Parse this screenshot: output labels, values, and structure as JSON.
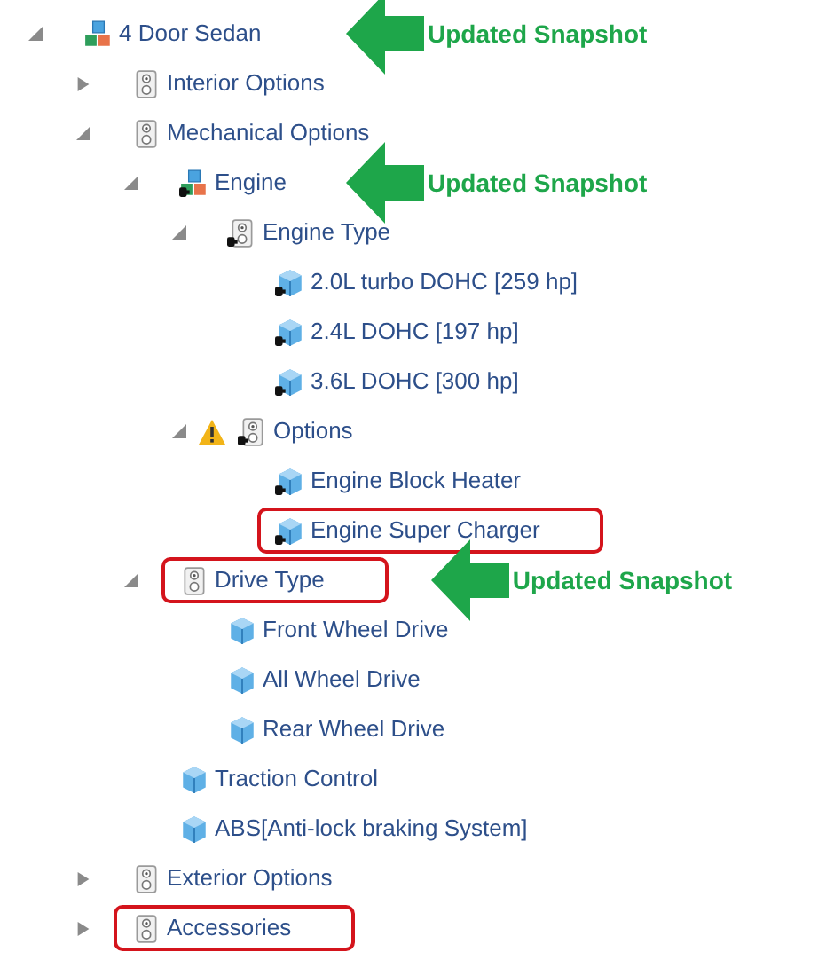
{
  "tree": [
    {
      "label": "4 Door Sedan",
      "kind": "model",
      "expanded": true,
      "callout": "Updated Snapshot",
      "children": [
        {
          "label": "Interior Options",
          "kind": "group",
          "expanded": false
        },
        {
          "label": "Mechanical Options",
          "kind": "group",
          "expanded": true,
          "children": [
            {
              "label": "Engine",
              "kind": "model-ref",
              "expanded": true,
              "callout": "Updated Snapshot",
              "children": [
                {
                  "label": "Engine Type",
                  "kind": "group-ref",
                  "expanded": true,
                  "children": [
                    {
                      "label": "2.0L turbo DOHC [259 hp]",
                      "kind": "item-ref"
                    },
                    {
                      "label": "2.4L DOHC [197 hp]",
                      "kind": "item-ref"
                    },
                    {
                      "label": "3.6L DOHC [300 hp]",
                      "kind": "item-ref"
                    }
                  ]
                },
                {
                  "label": "Options",
                  "kind": "group-ref",
                  "expanded": true,
                  "warning": true,
                  "children": [
                    {
                      "label": "Engine Block Heater",
                      "kind": "item-ref"
                    },
                    {
                      "label": "Engine Super Charger",
                      "kind": "item-ref",
                      "highlighted": true
                    }
                  ]
                }
              ]
            },
            {
              "label": "Drive Type",
              "kind": "group",
              "expanded": true,
              "highlighted": true,
              "callout": "Updated Snapshot",
              "children": [
                {
                  "label": "Front Wheel Drive",
                  "kind": "item"
                },
                {
                  "label": "All Wheel Drive",
                  "kind": "item"
                },
                {
                  "label": "Rear Wheel Drive",
                  "kind": "item"
                }
              ]
            },
            {
              "label": "Traction Control",
              "kind": "item"
            },
            {
              "label": "ABS[Anti-lock braking System]",
              "kind": "item"
            }
          ]
        },
        {
          "label": "Exterior Options",
          "kind": "group",
          "expanded": false
        },
        {
          "label": "Accessories",
          "kind": "group",
          "expanded": false,
          "highlighted": true
        }
      ]
    }
  ]
}
